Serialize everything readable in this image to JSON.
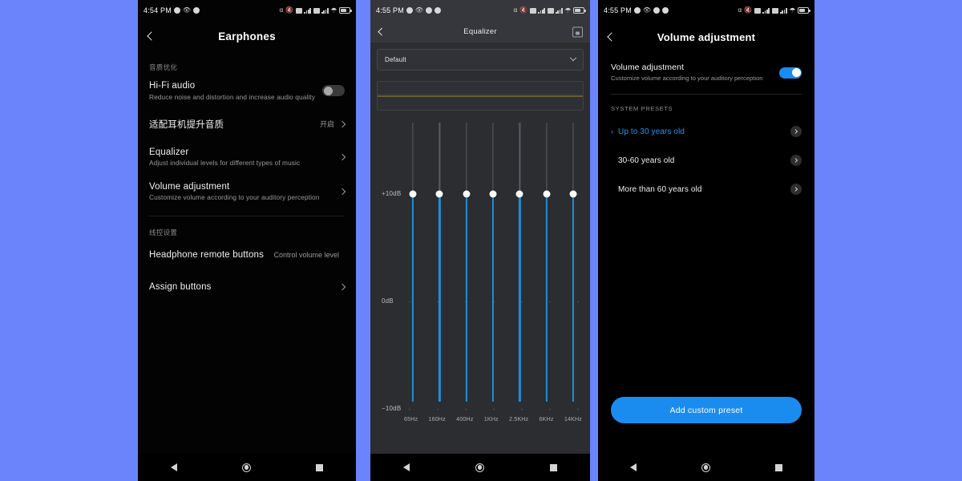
{
  "background_color": "#6b83fb",
  "accent_blue": "#1a8cf0",
  "phone1": {
    "statusbar": {
      "time": "4:54 PM",
      "left_icons": [
        "message-dot-icon",
        "eye-icon",
        "location-dot-icon"
      ],
      "right_icons": [
        "headphone-icon",
        "mute-icon",
        "sim1-icon",
        "signal1-icon",
        "sim2-icon",
        "signal2-icon",
        "wifi-icon",
        "battery-icon"
      ]
    },
    "header": {
      "back": "back-icon",
      "title": "Earphones"
    },
    "section1_label": "音质优化",
    "rows": [
      {
        "title": "Hi-Fi audio",
        "subtitle": "Reduce noise and distortion and increase audio quality",
        "control": "toggle",
        "toggle_on": false
      },
      {
        "title": "适配耳机提升音质",
        "subtitle": "",
        "value": "开启",
        "control": "chevron"
      },
      {
        "title": "Equalizer",
        "subtitle": "Adjust individual levels for different types of music",
        "control": "chevron"
      },
      {
        "title": "Volume adjustment",
        "subtitle": "Customize volume according to your auditory perception",
        "control": "chevron"
      }
    ],
    "section2_label": "线控设置",
    "rows2": [
      {
        "title": "Headphone remote buttons",
        "subtitle": "",
        "value": "Control volume level",
        "control": "none"
      },
      {
        "title": "Assign buttons",
        "subtitle": "",
        "control": "chevron"
      }
    ],
    "navbar": [
      "back-nav-icon",
      "home-nav-icon",
      "recents-nav-icon"
    ]
  },
  "phone2": {
    "statusbar": {
      "time": "4:55 PM",
      "left_icons": [
        "message-dot-icon",
        "eye-icon",
        "location-dot-icon",
        "location-dot-icon"
      ],
      "right_icons": [
        "headphone-icon",
        "mute-icon",
        "sim1-icon",
        "signal1-icon",
        "sim2-icon",
        "signal2-icon",
        "wifi-icon",
        "battery-icon"
      ]
    },
    "header": {
      "back": "back-icon",
      "title": "Equalizer",
      "action": "save-icon"
    },
    "preset_select": {
      "value": "Default",
      "chevron": "chevron-down-icon"
    },
    "chart_data": {
      "type": "line",
      "title": "Equalizer response curve",
      "x": [
        0,
        10,
        20,
        30,
        40,
        50,
        60,
        70,
        80,
        90,
        100
      ],
      "values": [
        0,
        0,
        0,
        0,
        0,
        0,
        0,
        0,
        0,
        0,
        0
      ],
      "line_color": "#8a7a33",
      "grid": false,
      "xlabel": "",
      "ylabel": ""
    },
    "equalizer": {
      "type": "bar",
      "title": "Equalizer band levels",
      "categories": [
        "65Hz",
        "160Hz",
        "400Hz",
        "1KHz",
        "2.5KHz",
        "6KHz",
        "14KHz"
      ],
      "values": [
        10,
        10,
        10,
        10,
        10,
        10,
        10
      ],
      "ylabel": "dB",
      "ylim": [
        -10,
        20
      ],
      "axis_labels": [
        "+10dB",
        "0dB",
        "−10dB"
      ],
      "unit": "dB"
    },
    "navbar": [
      "back-nav-icon",
      "home-nav-icon",
      "recents-nav-icon"
    ]
  },
  "phone3": {
    "statusbar": {
      "time": "4:55 PM",
      "left_icons": [
        "message-dot-icon",
        "eye-icon",
        "location-dot-icon",
        "location-dot-icon"
      ],
      "right_icons": [
        "headphone-icon",
        "mute-icon",
        "sim1-icon",
        "signal1-icon",
        "sim2-icon",
        "signal2-icon",
        "wifi-icon",
        "battery-icon"
      ]
    },
    "header": {
      "back": "back-icon",
      "title": "Volume adjustment"
    },
    "main_toggle": {
      "title": "Volume adjustment",
      "subtitle": "Customize volume according to your auditory perception",
      "toggle_on": true
    },
    "section_label": "SYSTEM PRESETS",
    "presets": [
      {
        "label": "Up to 30 years old",
        "selected": true
      },
      {
        "label": "30-60 years old",
        "selected": false
      },
      {
        "label": "More than 60 years old",
        "selected": false
      }
    ],
    "add_button": "Add custom preset",
    "navbar": [
      "back-nav-icon",
      "home-nav-icon",
      "recents-nav-icon"
    ]
  }
}
